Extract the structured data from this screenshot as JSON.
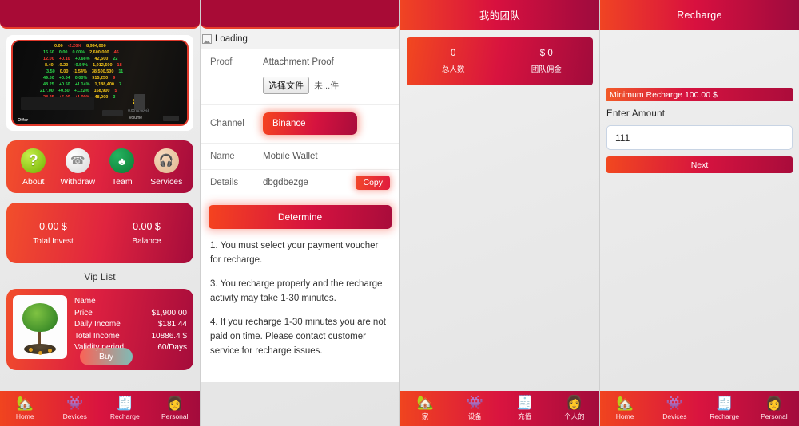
{
  "colors": {
    "header_solid": "#a80b36",
    "accent_orange": "#f2481f",
    "accent_crimson": "#d6133f",
    "accent_dark": "#a10b3c",
    "page_bg": "#eaeaea"
  },
  "panel_home": {
    "banner": {
      "alt": "stock-ticker-board",
      "rows": [
        {
          "price": "",
          "change": "0.00",
          "pct": "-2.20%"
        },
        {
          "price": "16.50",
          "change": "0.00",
          "pct": "0.00%"
        },
        {
          "price": "12.00",
          "change": "+0.10",
          "pct": "+0.66%"
        },
        {
          "price": "8.40",
          "change": "-0.20",
          "pct": "+0.54%"
        },
        {
          "price": "3.50",
          "change": "0.00",
          "pct": "-1.54%"
        },
        {
          "price": "49.50",
          "change": "+0.04",
          "pct": "0.00%"
        },
        {
          "price": "48.25",
          "change": "+0.50",
          "pct": "+1.14%"
        },
        {
          "price": "217.00",
          "change": "+0.50",
          "pct": "+1.22%"
        },
        {
          "price": "28.25",
          "change": "+5.00",
          "pct": "+1.09%"
        }
      ],
      "big_value": "2.28",
      "big_sub": "0.00 (0.00%)",
      "volume_label": "Volume",
      "offer_label": "Offer"
    },
    "quick_actions": [
      {
        "label": "About",
        "icon": "question-mark-icon",
        "glyph": "?"
      },
      {
        "label": "Withdraw",
        "icon": "phone-icon",
        "glyph": "☎"
      },
      {
        "label": "Team",
        "icon": "people-circle-icon",
        "glyph": "♣"
      },
      {
        "label": "Services",
        "icon": "headset-support-icon",
        "glyph": "🎧"
      }
    ],
    "stats": [
      {
        "value": "0.00 $",
        "label": "Total Invest"
      },
      {
        "value": "0.00 $",
        "label": "Balance"
      }
    ],
    "vip_list_title": "Vip List",
    "vip_card": {
      "image_alt": "money-tree-image",
      "rows": [
        {
          "label": "Name",
          "value": ""
        },
        {
          "label": "Price",
          "value": "$1,900.00"
        },
        {
          "label": "Daily Income",
          "value": "$181.44"
        },
        {
          "label": "Total Income",
          "value": "10886.4 $"
        },
        {
          "label": "Validity period",
          "value": "60/Days"
        }
      ],
      "buy_label": "Buy"
    },
    "nav": [
      {
        "label": "Home",
        "icon": "home-icon",
        "glyph": "🏡"
      },
      {
        "label": "Devices",
        "icon": "devices-icon",
        "glyph": "👾"
      },
      {
        "label": "Recharge",
        "icon": "recharge-icon",
        "glyph": "🧾"
      },
      {
        "label": "Personal",
        "icon": "person-icon",
        "glyph": "👩"
      }
    ]
  },
  "panel_proof": {
    "loading_alt": "Loading",
    "proof": {
      "label": "Proof",
      "value": "Attachment Proof",
      "file_button": "选择文件",
      "file_status": "未...件"
    },
    "channel": {
      "label": "Channel",
      "value": "Binance"
    },
    "name": {
      "label": "Name",
      "value": "Mobile Wallet"
    },
    "details": {
      "label": "Details",
      "value": "dbgdbezge",
      "copy_label": "Copy"
    },
    "determine_label": "Determine",
    "notes": [
      "1. You must select your payment voucher for recharge.",
      "3. You recharge properly and the recharge activity may take 1-30 minutes.",
      "4. If you recharge 1-30 minutes you are not paid on time. Please contact customer service for recharge issues."
    ]
  },
  "panel_team": {
    "title": "我的团队",
    "stats": [
      {
        "value": "0",
        "label": "总人数"
      },
      {
        "value": "$ 0",
        "label": "团队佣金"
      }
    ],
    "nav": [
      {
        "label": "家",
        "icon": "home-icon",
        "glyph": "🏡"
      },
      {
        "label": "设备",
        "icon": "devices-icon",
        "glyph": "👾"
      },
      {
        "label": "充值",
        "icon": "recharge-icon",
        "glyph": "🧾"
      },
      {
        "label": "个人的",
        "icon": "person-icon",
        "glyph": "👩"
      }
    ]
  },
  "panel_recharge": {
    "title": "Recharge",
    "minimum_text": "Minimum Recharge 100.00 $",
    "enter_amount_label": "Enter Amount",
    "amount_value": "111",
    "amount_placeholder": "",
    "next_label": "Next",
    "nav": [
      {
        "label": "Home",
        "icon": "home-icon",
        "glyph": "🏡"
      },
      {
        "label": "Devices",
        "icon": "devices-icon",
        "glyph": "👾"
      },
      {
        "label": "Recharge",
        "icon": "recharge-icon",
        "glyph": "🧾"
      },
      {
        "label": "Personal",
        "icon": "person-icon",
        "glyph": "👩"
      }
    ]
  }
}
